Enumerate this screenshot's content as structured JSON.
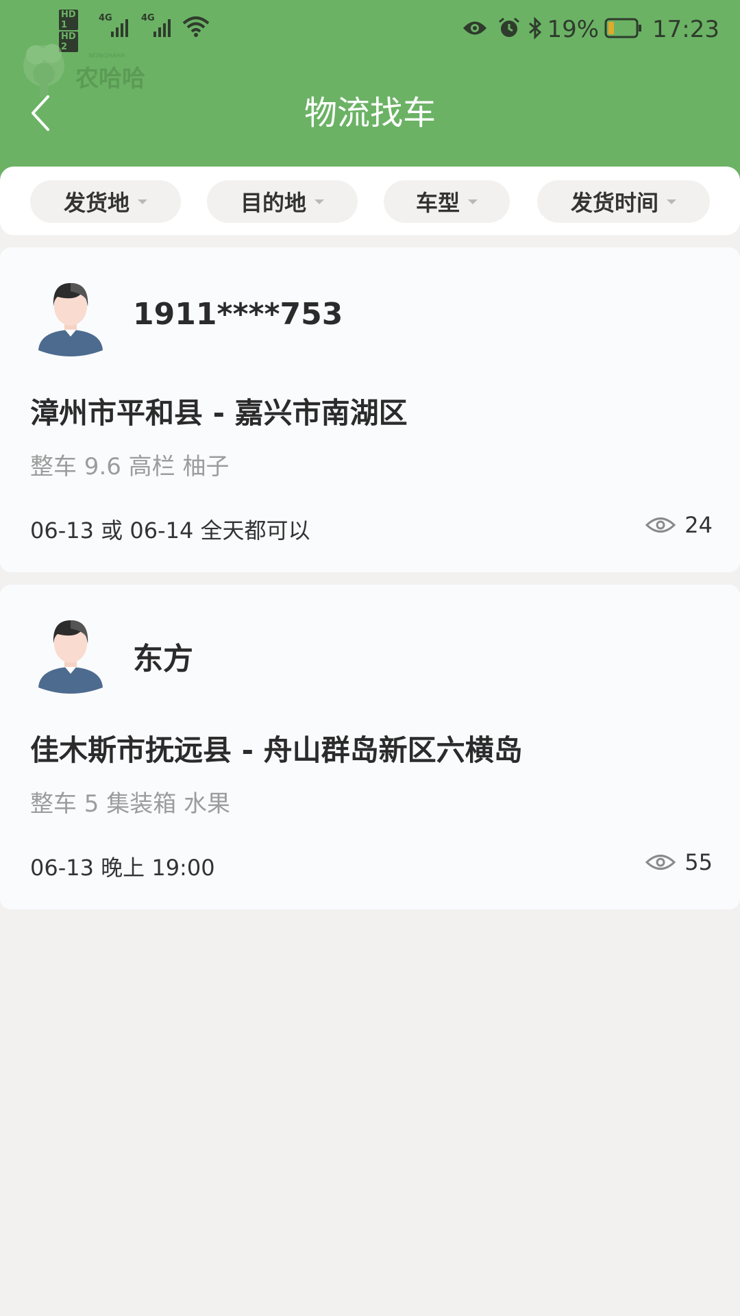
{
  "status_bar": {
    "sim1": "HD 1",
    "sim2": "HD 2",
    "net1": "4G",
    "net2": "4G",
    "battery": "19%",
    "time": "17:23",
    "icons": [
      "eye-icon",
      "alarm-icon",
      "bluetooth-icon",
      "battery-icon",
      "wifi-icon",
      "signal-icon"
    ]
  },
  "header": {
    "title": "物流找车",
    "logo_text": "农哈哈",
    "logo_sub": "NONGHAHA",
    "back_icon": "chevron-left-icon"
  },
  "filters": [
    {
      "label": "发货地"
    },
    {
      "label": "目的地"
    },
    {
      "label": "车型"
    },
    {
      "label": "发货时间"
    }
  ],
  "listings": [
    {
      "name": "1911****753",
      "route": "漳州市平和县 - 嘉兴市南湖区",
      "spec": "整车 9.6 高栏 柚子",
      "time": "06-13 或 06-14 全天都可以",
      "views": "24"
    },
    {
      "name": "东方",
      "route": "佳木斯市抚远县 - 舟山群岛新区六横岛",
      "spec": "整车 5 集装箱 水果",
      "time": "06-13 晚上 19:00",
      "views": "55"
    }
  ],
  "colors": {
    "header_bg": "#6bb265",
    "page_bg": "#f2f1f0",
    "card_bg": "#fafbfd",
    "chip_bg": "#f2f1ef",
    "text_primary": "#2b2b2b",
    "text_secondary": "#9c9c9c"
  }
}
